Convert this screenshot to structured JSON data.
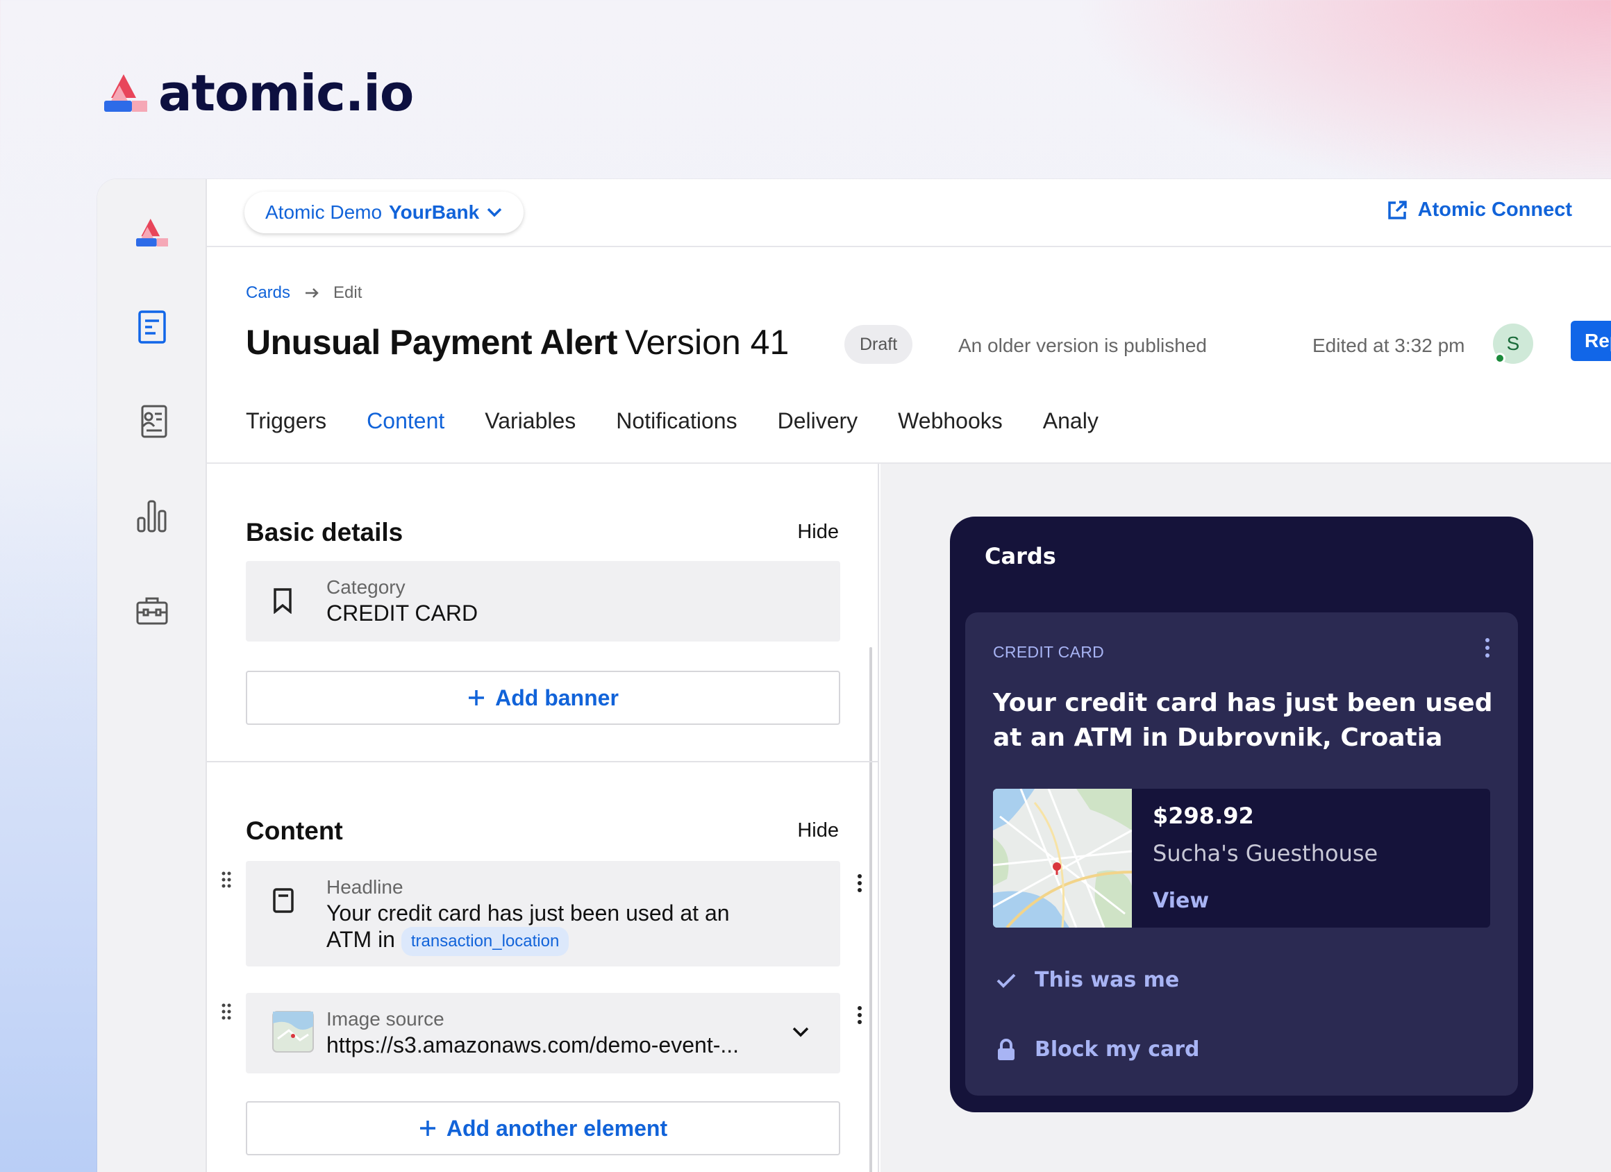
{
  "brand": {
    "name": "atomic.io",
    "colors": {
      "accent": "#1163d9",
      "navy": "#0d1040",
      "red": "#e8455a"
    }
  },
  "topbar": {
    "org_prefix": "Atomic Demo",
    "org_name": "YourBank",
    "org_icon": "chevron-down-icon",
    "connect_label": "Atomic Connect",
    "connect_icon": "external-link-icon"
  },
  "sidebar": {
    "items": [
      {
        "name": "logo-icon"
      },
      {
        "name": "document-icon"
      },
      {
        "name": "contact-card-icon"
      },
      {
        "name": "bar-chart-icon"
      },
      {
        "name": "toolbox-icon"
      }
    ]
  },
  "header": {
    "breadcrumb": {
      "parent": "Cards",
      "current": "Edit"
    },
    "title": "Unusual Payment Alert",
    "version": "Version 41",
    "status_badge": "Draft",
    "status_note": "An older version is published",
    "edited": "Edited at 3:32 pm",
    "avatar_initial": "S",
    "republish_label": "Republish"
  },
  "tabs": [
    {
      "label": "Triggers",
      "active": false
    },
    {
      "label": "Content",
      "active": true
    },
    {
      "label": "Variables",
      "active": false
    },
    {
      "label": "Notifications",
      "active": false
    },
    {
      "label": "Delivery",
      "active": false
    },
    {
      "label": "Webhooks",
      "active": false
    },
    {
      "label": "Analy",
      "active": false
    }
  ],
  "editor": {
    "basic": {
      "title": "Basic details",
      "hide_label": "Hide",
      "category_label": "Category",
      "category_value": "CREDIT CARD",
      "add_banner_label": "Add banner"
    },
    "content": {
      "title": "Content",
      "hide_label": "Hide",
      "headline_label": "Headline",
      "headline_line1": "Your credit card has just been used at an",
      "headline_line2": "ATM in",
      "headline_token": "transaction_location",
      "image_label": "Image source",
      "image_value": "https://s3.amazonaws.com/demo-event-...",
      "add_element_label": "Add another element"
    }
  },
  "preview": {
    "title": "Cards",
    "card": {
      "category": "CREDIT CARD",
      "headline": "Your credit card has just been used at an ATM in Dubrovnik, Croatia",
      "amount": "$298.92",
      "merchant": "Sucha's Guesthouse",
      "view_label": "View",
      "action_primary": "This was me",
      "action_secondary": "Block my card"
    }
  }
}
